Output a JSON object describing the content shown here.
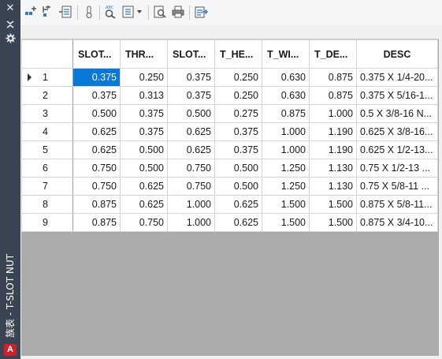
{
  "palette": {
    "title": "族表 - T-SLOT NUT",
    "logo": "A"
  },
  "toolbar": {
    "icons": [
      "add-column-icon",
      "add-row-icon",
      "edit-table-icon",
      "thermometer-icon",
      "find-icon",
      "sheet-options-icon",
      "dropdown-arrow-icon",
      "preview-icon",
      "print-icon",
      "export-icon"
    ]
  },
  "grid": {
    "columns": [
      "SLOT...",
      "THR...",
      "SLOT...",
      "T_HE...",
      "T_WI...",
      "T_DE...",
      "DESC"
    ],
    "selected_cell": "row 1, column SLOT...",
    "rows": [
      {
        "num": "1",
        "cells": [
          "0.375",
          "0.250",
          "0.375",
          "0.250",
          "0.630",
          "0.875",
          "0.375 X 1/4-20..."
        ]
      },
      {
        "num": "2",
        "cells": [
          "0.375",
          "0.313",
          "0.375",
          "0.250",
          "0.630",
          "0.875",
          "0.375 X 5/16-1..."
        ]
      },
      {
        "num": "3",
        "cells": [
          "0.500",
          "0.375",
          "0.500",
          "0.275",
          "0.875",
          "1.000",
          "0.5 X 3/8-16 N..."
        ]
      },
      {
        "num": "4",
        "cells": [
          "0.625",
          "0.375",
          "0.625",
          "0.375",
          "1.000",
          "1.190",
          "0.625 X 3/8-16..."
        ]
      },
      {
        "num": "5",
        "cells": [
          "0.625",
          "0.500",
          "0.625",
          "0.375",
          "1.000",
          "1.190",
          "0.625 X 1/2-13..."
        ]
      },
      {
        "num": "6",
        "cells": [
          "0.750",
          "0.500",
          "0.750",
          "0.500",
          "1.250",
          "1.130",
          "0.75 X 1/2-13 ..."
        ]
      },
      {
        "num": "7",
        "cells": [
          "0.750",
          "0.625",
          "0.750",
          "0.500",
          "1.250",
          "1.130",
          "0.75 X 5/8-11 ..."
        ]
      },
      {
        "num": "8",
        "cells": [
          "0.875",
          "0.625",
          "1.000",
          "0.625",
          "1.500",
          "1.500",
          "0.875 X 5/8-11..."
        ]
      },
      {
        "num": "9",
        "cells": [
          "0.875",
          "0.750",
          "1.000",
          "0.625",
          "1.500",
          "1.500",
          "0.875 X 3/4-10..."
        ]
      }
    ]
  },
  "colors": {
    "palette_bg": "#3b4453",
    "selection": "#0a78d7",
    "empty_area": "#ababab"
  }
}
